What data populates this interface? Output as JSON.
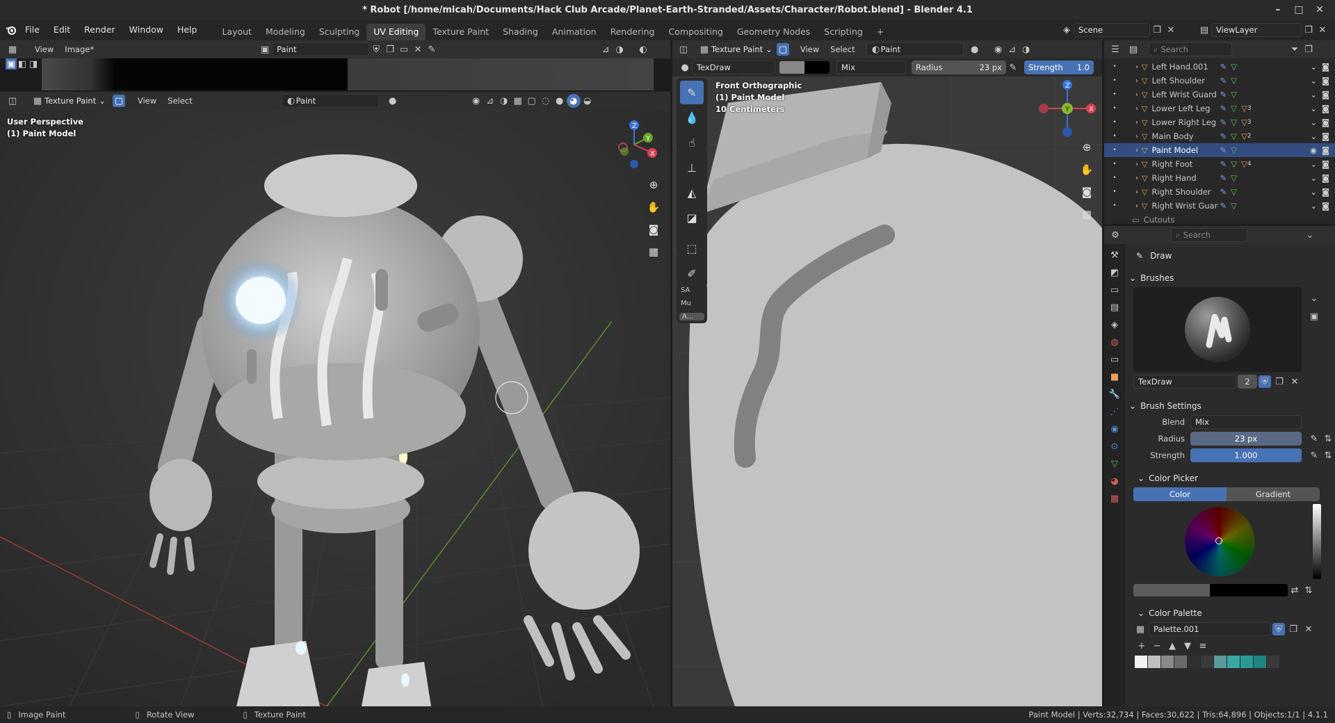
{
  "window": {
    "title": "* Robot [/home/micah/Documents/Hack Club Arcade/Planet-Earth-Stranded/Assets/Character/Robot.blend] - Blender 4.1",
    "minimize": "–",
    "maximize": "□",
    "close": "✕"
  },
  "menu": {
    "items": [
      "File",
      "Edit",
      "Render",
      "Window",
      "Help"
    ],
    "tabs": [
      "Layout",
      "Modeling",
      "Sculpting",
      "UV Editing",
      "Texture Paint",
      "Shading",
      "Animation",
      "Rendering",
      "Compositing",
      "Geometry Nodes",
      "Scripting"
    ],
    "active_tab": "UV Editing",
    "add_tab": "+",
    "scene": "Scene",
    "view_layer": "ViewLayer"
  },
  "image_editor": {
    "view": "View",
    "image": "Image*",
    "mode": "Paint"
  },
  "viewport3d": {
    "mode": "Texture Paint",
    "view": "View",
    "select": "Select",
    "material": "Paint",
    "overlay_line1": "User Perspective",
    "overlay_line2": "(1) Paint Model"
  },
  "viewport2": {
    "mode": "Texture Paint",
    "view": "View",
    "select": "Select",
    "material": "Paint",
    "brush": "TexDraw",
    "blend": "Mix",
    "radius_label": "Radius",
    "radius_value": "23 px",
    "strength_label": "Strength",
    "strength_value": "1.0",
    "overlay_line1": "Front Orthographic",
    "overlay_line2": "(1) Paint Model",
    "overlay_line3": "10 Centimeters",
    "tool_labels": [
      "SA",
      "Mu",
      "A..."
    ]
  },
  "outliner": {
    "search_placeholder": "Search",
    "rows": [
      {
        "name": "Left Hand.001",
        "badge": "",
        "selected": false
      },
      {
        "name": "Left Shoulder",
        "badge": "",
        "selected": false
      },
      {
        "name": "Left Wrist Guard",
        "badge": "",
        "selected": false
      },
      {
        "name": "Lower Left Leg",
        "badge": "3",
        "selected": false
      },
      {
        "name": "Lower Right Leg",
        "badge": "3",
        "selected": false
      },
      {
        "name": "Main Body",
        "badge": "2",
        "selected": false
      },
      {
        "name": "Paint Model",
        "badge": "",
        "selected": true
      },
      {
        "name": "Right Foot",
        "badge": "4",
        "selected": false
      },
      {
        "name": "Right Hand",
        "badge": "",
        "selected": false
      },
      {
        "name": "Right Shoulder",
        "badge": "",
        "selected": false
      },
      {
        "name": "Right Wrist Guard",
        "badge": "",
        "selected": false
      }
    ],
    "collection": "Cutouts"
  },
  "properties": {
    "search_placeholder": "Search",
    "tool_name": "Draw",
    "brushes_header": "Brushes",
    "brush_name": "TexDraw",
    "brush_users": "2",
    "brush_settings_header": "Brush Settings",
    "blend_label": "Blend",
    "blend_value": "Mix",
    "radius_label": "Radius",
    "radius_value": "23 px",
    "strength_label": "Strength",
    "strength_value": "1.000",
    "color_picker_header": "Color Picker",
    "color_tab": "Color",
    "gradient_tab": "Gradient",
    "color_palette_header": "Color Palette",
    "palette_name": "Palette.001",
    "palette_colors": [
      "#f2f2f2",
      "#c0c0c0",
      "#8a8a8a",
      "#6a6a6a",
      "#303030",
      "#3a3a3a",
      "#5a9a98",
      "#3aa8a4",
      "#2a9a94",
      "#1f8580",
      "#3a3a3a"
    ]
  },
  "status": {
    "left1": "Image Paint",
    "left2": "Rotate View",
    "left3": "Texture Paint",
    "right": "Paint Model | Verts:32,734 | Faces:30,622 | Tris:64,896 | Objects:1/1 | 4.1.1"
  },
  "colors": {
    "accent": "#4772b3",
    "selected_row": "#334d80",
    "object_icon": "#e8a05a"
  }
}
